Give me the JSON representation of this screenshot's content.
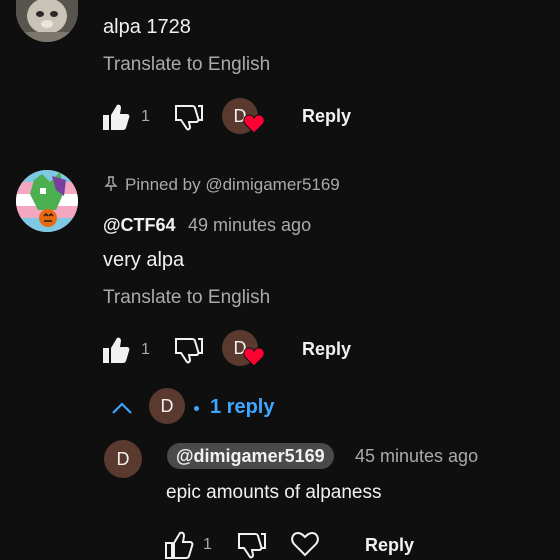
{
  "comment1": {
    "text": "alpa 1728",
    "translate": "Translate to English",
    "likes": "1",
    "creator_initial": "D",
    "reply_label": "Reply"
  },
  "comment2": {
    "pinned": "Pinned by @dimigamer5169",
    "author": "@CTF64",
    "time": "49 minutes ago",
    "text": "very alpa",
    "translate": "Translate to English",
    "likes": "1",
    "creator_initial": "D",
    "reply_label": "Reply",
    "replies_initial": "D",
    "replies_label": "1 reply"
  },
  "reply1": {
    "initial": "D",
    "author": "@dimigamer5169",
    "time": "45 minutes ago",
    "text": "epic amounts of alpaness",
    "likes": "1",
    "reply_label": "Reply"
  },
  "colors": {
    "background": "#0f0f0f",
    "accent_blue": "#3ea6ff",
    "heart_red": "#ff0033",
    "secondary_text": "#aaaaaa"
  }
}
